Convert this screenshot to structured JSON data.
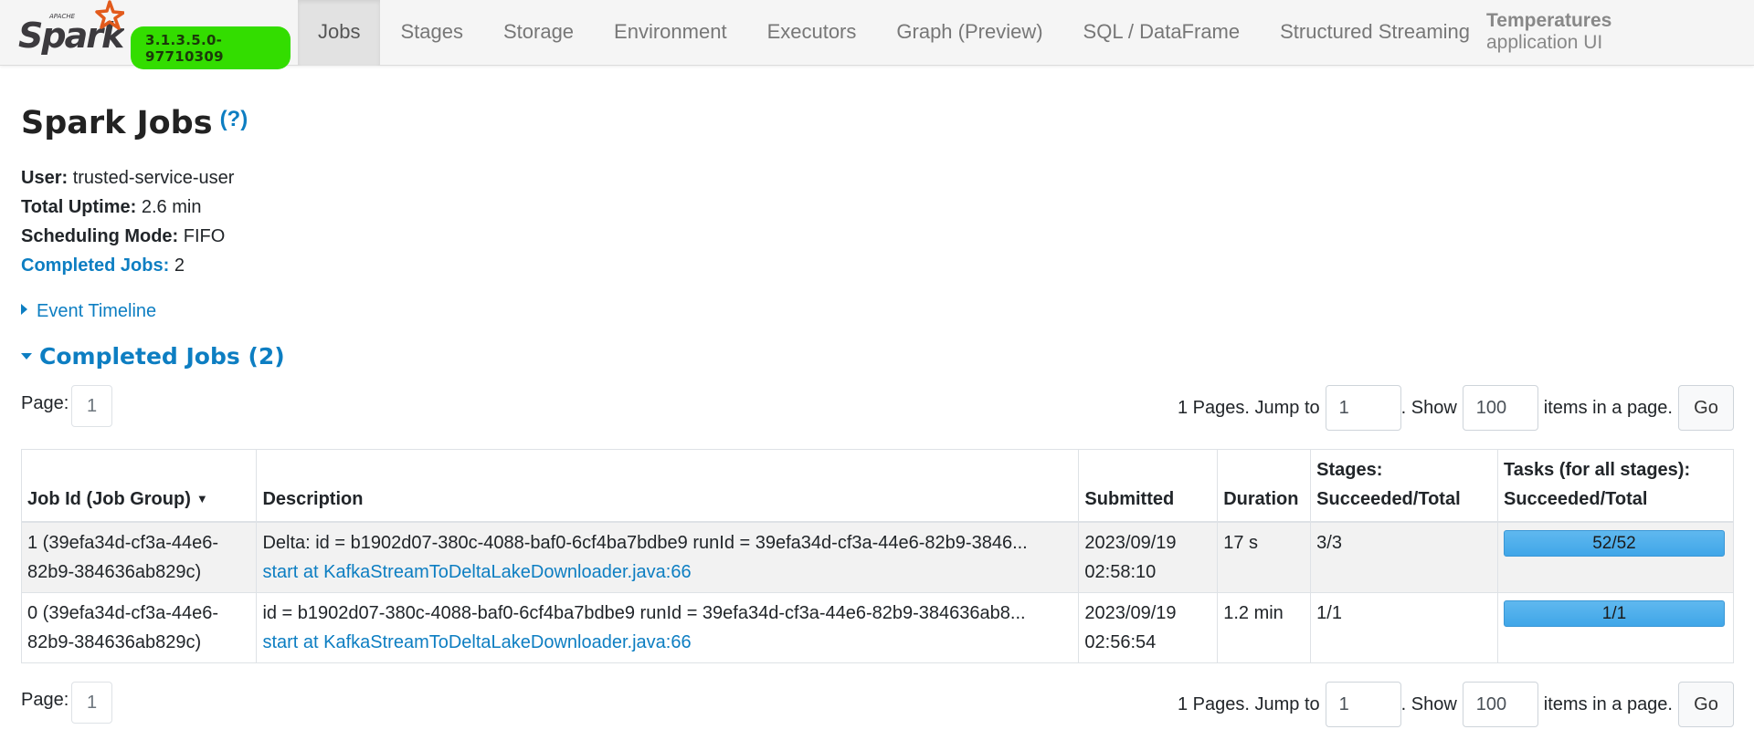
{
  "brand": {
    "apache_label": "APACHE",
    "logo_text": "Spark",
    "version": "3.1.3.5.0-97710309",
    "colors": {
      "logo_orange": "#e25a1c",
      "logo_text": "#3c3a3e",
      "version_highlight": "#33dd00"
    }
  },
  "nav": {
    "tabs": [
      {
        "label": "Jobs",
        "active": true
      },
      {
        "label": "Stages"
      },
      {
        "label": "Storage"
      },
      {
        "label": "Environment"
      },
      {
        "label": "Executors"
      },
      {
        "label": "Graph (Preview)"
      },
      {
        "label": "SQL / DataFrame"
      },
      {
        "label": "Structured Streaming"
      }
    ],
    "app_name": "Temperatures",
    "app_suffix": "application UI"
  },
  "page": {
    "title": "Spark Jobs",
    "help": "(?)",
    "summary": {
      "user_label": "User:",
      "user_value": "trusted-service-user",
      "uptime_label": "Total Uptime:",
      "uptime_value": "2.6 min",
      "mode_label": "Scheduling Mode:",
      "mode_value": "FIFO",
      "completed_label": "Completed Jobs:",
      "completed_value": "2"
    },
    "event_timeline": "Event Timeline",
    "completed_section": "Completed Jobs (2)"
  },
  "pager": {
    "page_label": "Page:",
    "current_page": "1",
    "pages_text": "1 Pages. Jump to",
    "jump_value": "1",
    "show_text": ". Show",
    "show_value": "100",
    "items_text": "items in a page.",
    "go_label": "Go"
  },
  "table": {
    "headers": {
      "job_id": "Job Id (Job Group)",
      "sort_indicator": "▼",
      "description": "Description",
      "submitted": "Submitted",
      "duration": "Duration",
      "stages_line1": "Stages:",
      "stages_line2": "Succeeded/Total",
      "tasks_line1": "Tasks (for all stages):",
      "tasks_line2": "Succeeded/Total"
    },
    "rows": [
      {
        "job_id": "1 (39efa34d-cf3a-44e6-82b9-384636ab829c)",
        "description": "Delta: id = b1902d07-380c-4088-baf0-6cf4ba7bdbe9 runId = 39efa34d-cf3a-44e6-82b9-3846...",
        "link": "start at KafkaStreamToDeltaLakeDownloader.java:66",
        "submitted_date": "2023/09/19",
        "submitted_time": "02:58:10",
        "duration": "17 s",
        "stages": "3/3",
        "tasks": "52/52",
        "tasks_fraction": 1.0
      },
      {
        "job_id": "0 (39efa34d-cf3a-44e6-82b9-384636ab829c)",
        "description": "id = b1902d07-380c-4088-baf0-6cf4ba7bdbe9 runId = 39efa34d-cf3a-44e6-82b9-384636ab8...",
        "link": "start at KafkaStreamToDeltaLakeDownloader.java:66",
        "submitted_date": "2023/09/19",
        "submitted_time": "02:56:54",
        "duration": "1.2 min",
        "stages": "1/1",
        "tasks": "1/1",
        "tasks_fraction": 1.0
      }
    ]
  }
}
